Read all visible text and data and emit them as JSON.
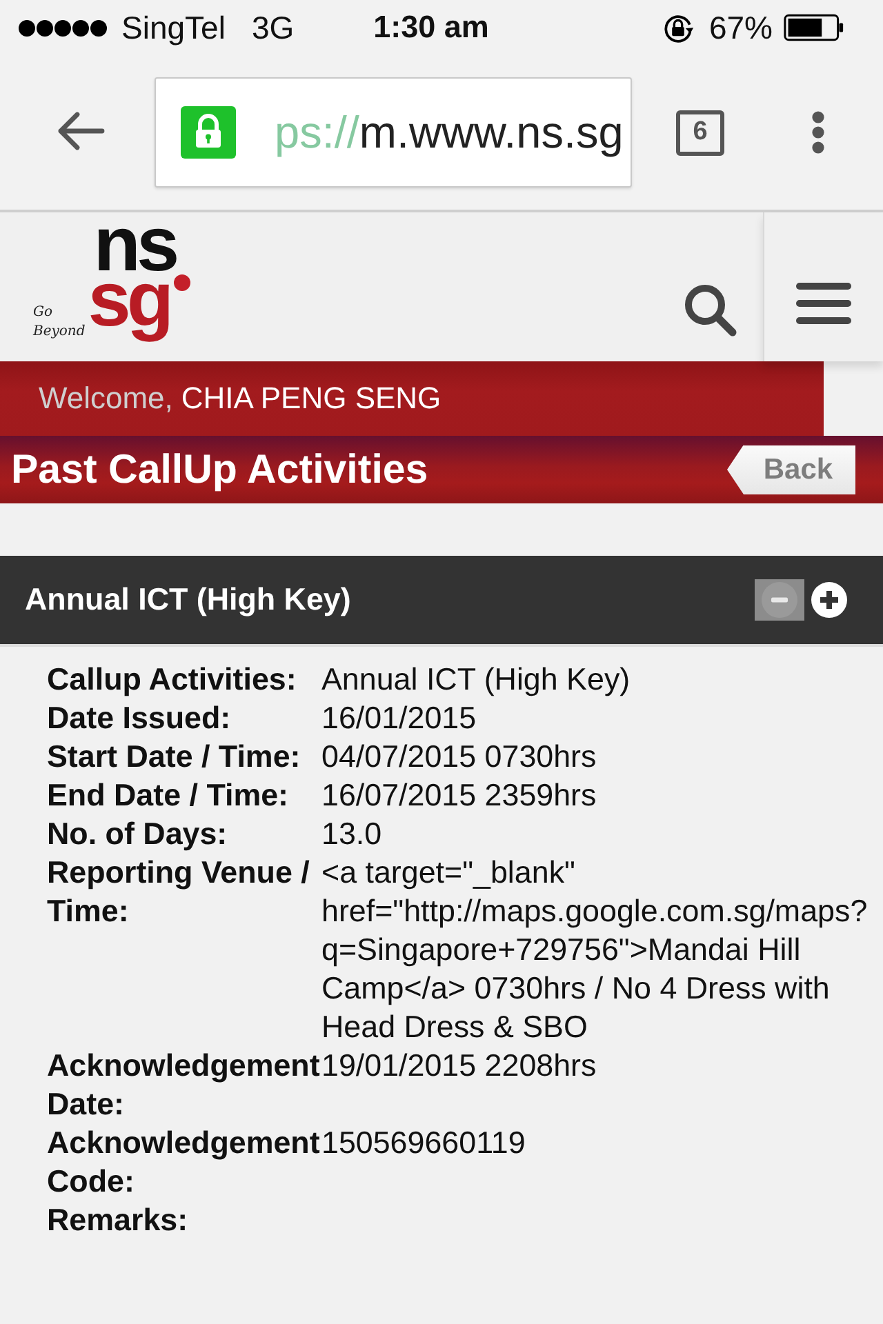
{
  "status_bar": {
    "carrier": "SingTel",
    "network": "3G",
    "time": "1:30 am",
    "battery": "67%"
  },
  "browser": {
    "url_parts": [
      {
        "text": "ps://",
        "kind": "scheme"
      },
      {
        "text": "m.www.ns.sg",
        "kind": "host"
      }
    ],
    "tab_count": "6"
  },
  "site_header": {
    "logo": {
      "top": "ns",
      "bottom": "sg",
      "tagline": [
        "Go",
        "Beyond"
      ]
    }
  },
  "welcome": {
    "greeting": "Welcome,",
    "name": "CHIA PENG SENG"
  },
  "page_title": "Past CallUp Activities",
  "back_button": "Back",
  "sections": [
    {
      "title": "Annual ICT (High Key)",
      "expanded": true,
      "fields": [
        {
          "label": "Callup Activities:",
          "value": "Annual ICT (High Key)"
        },
        {
          "label": "Date Issued:",
          "value": "16/01/2015"
        },
        {
          "label": "Start Date / Time:",
          "value": "04/07/2015 0730hrs"
        },
        {
          "label": "End Date / Time:",
          "value": "16/07/2015 2359hrs"
        },
        {
          "label": "No. of Days:",
          "value": "13.0"
        },
        {
          "label": "Reporting Venue / Time:",
          "value": "<a target=\"_blank\" href=\"http://maps.google.com.sg/maps?q=Singapore+729756\">Mandai Hill Camp</a> 0730hrs / No 4 Dress with Head Dress & SBO"
        },
        {
          "label": "Acknowledgement Date:",
          "value": "19/01/2015 2208hrs"
        },
        {
          "label": "Acknowledgement Code:",
          "value": "150569660119"
        },
        {
          "label": "Remarks:"
        }
      ]
    }
  ]
}
